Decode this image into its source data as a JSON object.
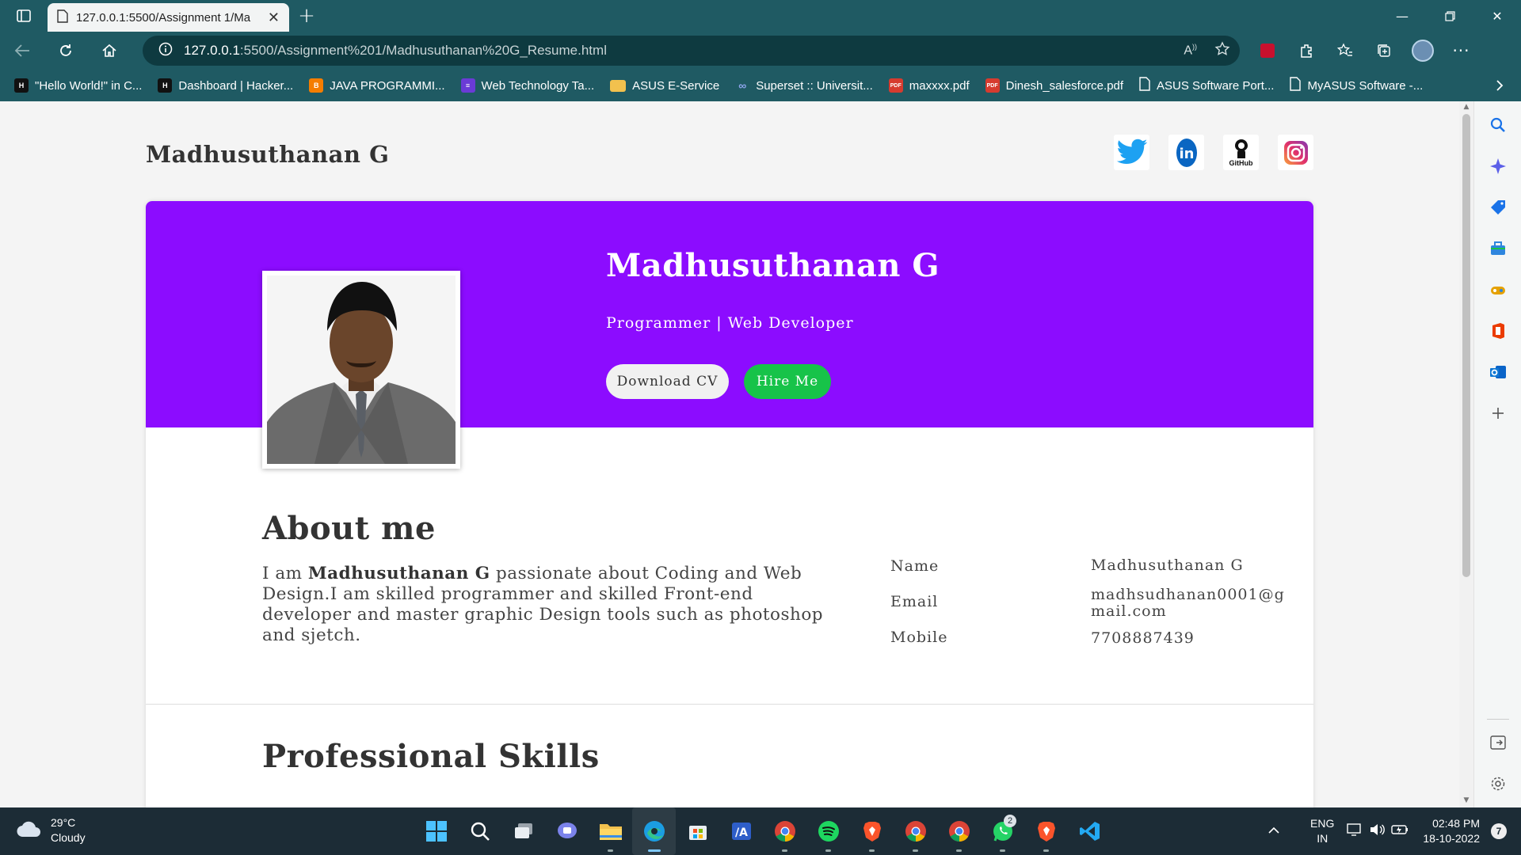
{
  "browser": {
    "tab_title": "127.0.0.1:5500/Assignment 1/Ma",
    "url_host": "127.0.0.1",
    "url_path": ":5500/Assignment%201/Madhusuthanan%20G_Resume.html",
    "theme_color": "#1f5a63"
  },
  "bookmarks": [
    {
      "label": "\"Hello World!\" in C...",
      "icon": "hackerrank-icon",
      "color": "#111111"
    },
    {
      "label": "Dashboard | Hacker...",
      "icon": "hackerrank-icon",
      "color": "#111111"
    },
    {
      "label": "JAVA PROGRAMMI...",
      "icon": "blogger-icon",
      "color": "#f57d00"
    },
    {
      "label": "Web Technology Ta...",
      "icon": "list-icon",
      "color": "#6a3bd6"
    },
    {
      "label": "ASUS E-Service",
      "icon": "folder-icon",
      "color": "#f2c14e"
    },
    {
      "label": "Superset :: Universit...",
      "icon": "superset-icon",
      "color": "#5a7bd8"
    },
    {
      "label": "maxxxx.pdf",
      "icon": "pdf-icon",
      "color": "#d63b2f"
    },
    {
      "label": "Dinesh_salesforce.pdf",
      "icon": "pdf-icon",
      "color": "#d63b2f"
    },
    {
      "label": "ASUS Software Port...",
      "icon": "page-icon",
      "color": "#ffffff"
    },
    {
      "label": "MyASUS Software -...",
      "icon": "page-icon",
      "color": "#ffffff"
    }
  ],
  "site": {
    "logo": "Madhusuthanan G",
    "social": [
      "twitter-icon",
      "linkedin-icon",
      "github-icon",
      "instagram-icon"
    ],
    "github_label": "GitHub"
  },
  "hero": {
    "name": "Madhusuthanan G",
    "role": "Programmer | Web Developer",
    "download_label": "Download CV",
    "hire_label": "Hire Me",
    "accent": "#8c0cff",
    "hire_color": "#17c349"
  },
  "about": {
    "title": "About me",
    "text_prefix": "I am ",
    "text_bold": "Madhusuthanan G",
    "text_suffix": " passionate about Coding and Web Design.I am skilled programmer and skilled Front-end developer and master graphic Design tools such as photoshop and sjetch.",
    "info": [
      {
        "label": "Name",
        "value": "Madhusuthanan G"
      },
      {
        "label": "Email",
        "value": "madhsudhanan0001@gmail.com"
      },
      {
        "label": "Mobile",
        "value": "7708887439"
      }
    ]
  },
  "skills": {
    "title": "Professional Skills"
  },
  "taskbar": {
    "temperature": "29°C",
    "weather": "Cloudy",
    "lang_top": "ENG",
    "lang_bottom": "IN",
    "time": "02:48 PM",
    "date": "18-10-2022",
    "notifications": "7",
    "whatsapp_badge": "2",
    "apps": [
      "windows-start-icon",
      "search-icon",
      "task-view-icon",
      "teams-chat-icon",
      "file-explorer-icon",
      "edge-icon",
      "store-icon",
      "vscode-alt-icon",
      "chrome-icon",
      "spotify-icon",
      "brave-icon",
      "chrome-icon",
      "chrome-icon",
      "whatsapp-icon",
      "brave-icon",
      "vscode-icon"
    ]
  }
}
